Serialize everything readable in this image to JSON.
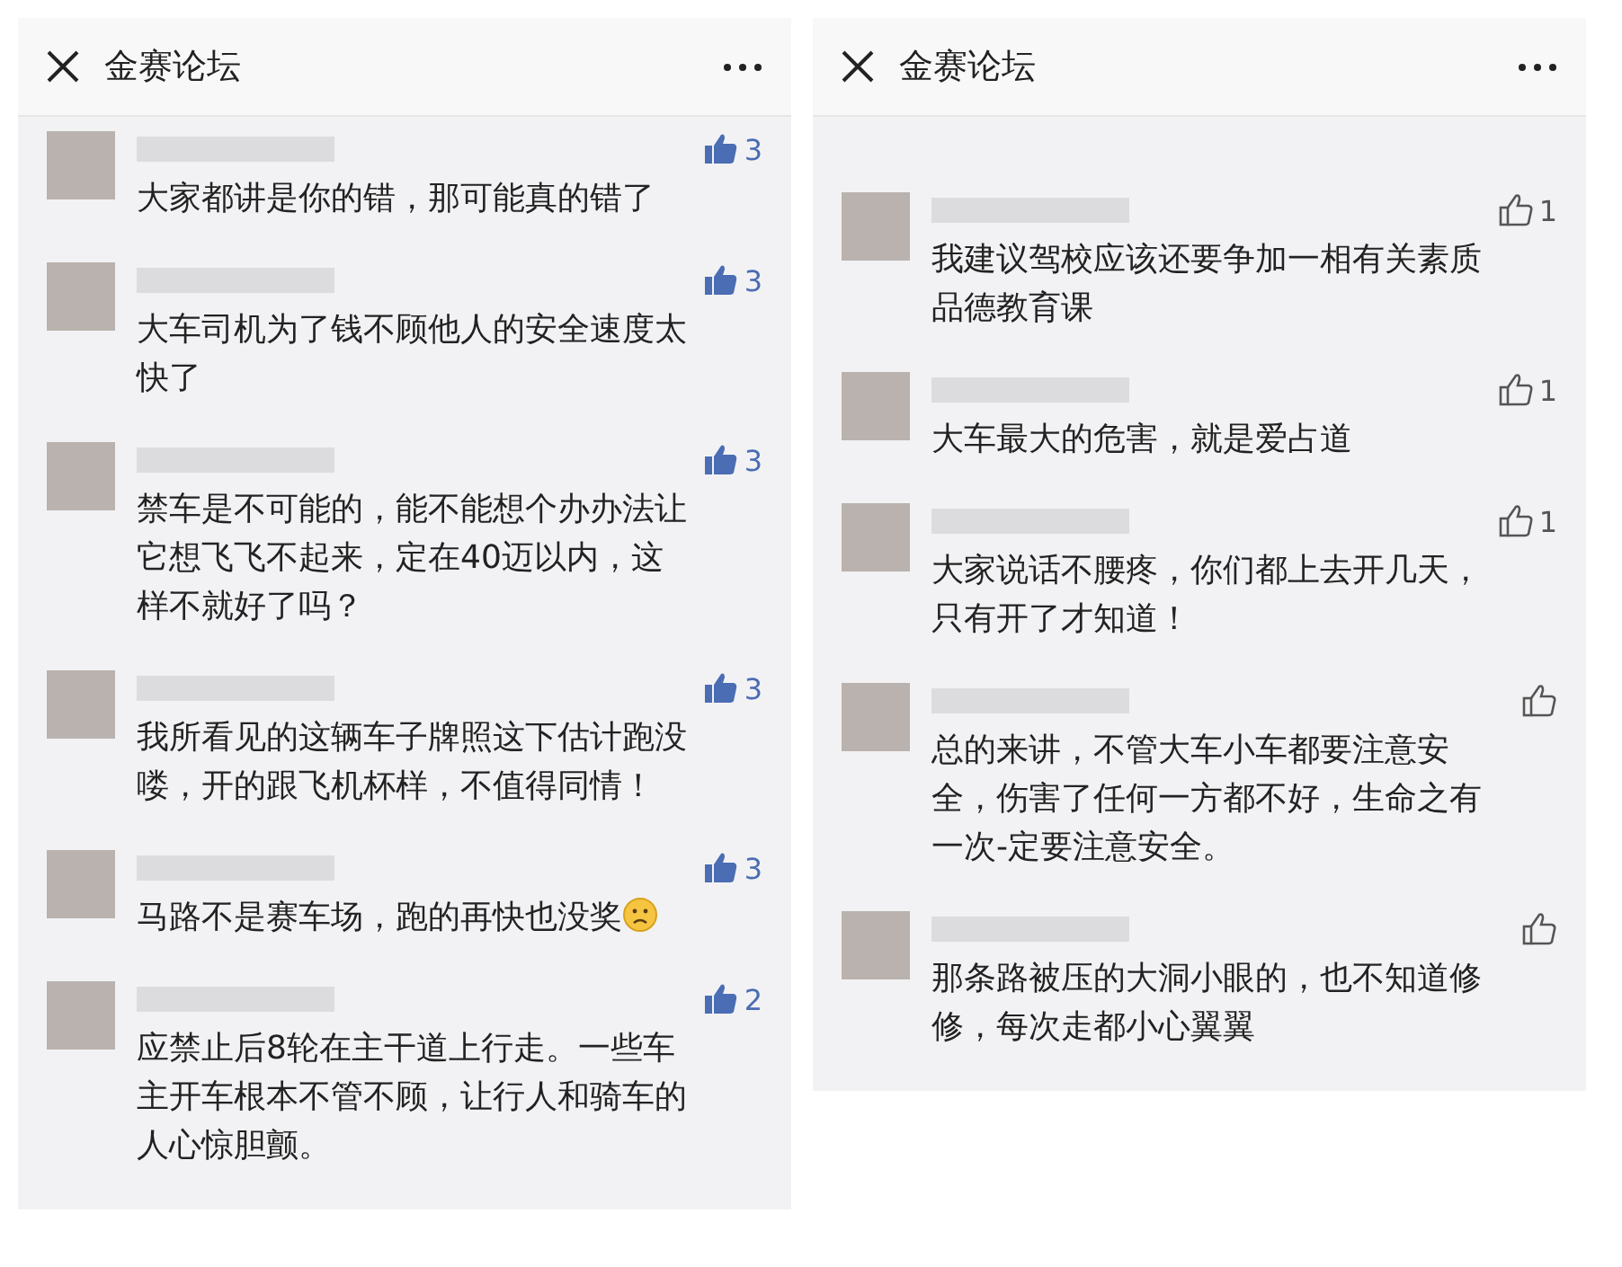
{
  "panels": [
    {
      "title": "金赛论坛",
      "comments": [
        {
          "text": "大家都讲是你的错，那可能真的错了",
          "likes": "3",
          "liked": true
        },
        {
          "text": "大车司机为了钱不顾他人的安全速度太快了",
          "likes": "3",
          "liked": true
        },
        {
          "text": "禁车是不可能的，能不能想个办办法让它想飞飞不起来，定在40迈以内，这样不就好了吗？",
          "likes": "3",
          "liked": true
        },
        {
          "text": "我所看见的这辆车子牌照这下估计跑没喽，开的跟飞机杯样，不值得同情！",
          "likes": "3",
          "liked": true
        },
        {
          "text": "马路不是赛车场，跑的再快也没奖",
          "likes": "3",
          "liked": true,
          "sad_emoji": true
        },
        {
          "text": "应禁止后8轮在主干道上行走。一些车主开车根本不管不顾，让行人和骑车的人心惊胆颤。",
          "likes": "2",
          "liked": true
        }
      ]
    },
    {
      "title": "金赛论坛",
      "comments": [
        {
          "text": "我建议驾校应该还要争加一相有关素质品德教育课",
          "likes": "1",
          "liked": false
        },
        {
          "text": "大车最大的危害，就是爱占道",
          "likes": "1",
          "liked": false
        },
        {
          "text": "大家说话不腰疼，你们都上去开几天，只有开了才知道！",
          "likes": "1",
          "liked": false
        },
        {
          "text": "总的来讲，不管大车小车都要注意安全，伤害了任何一方都不好，生命之有一次-定要注意安全。",
          "liked": false
        },
        {
          "text": "那条路被压的大洞小眼的，也不知道修修，每次走都小心翼翼",
          "liked": false
        }
      ]
    }
  ]
}
